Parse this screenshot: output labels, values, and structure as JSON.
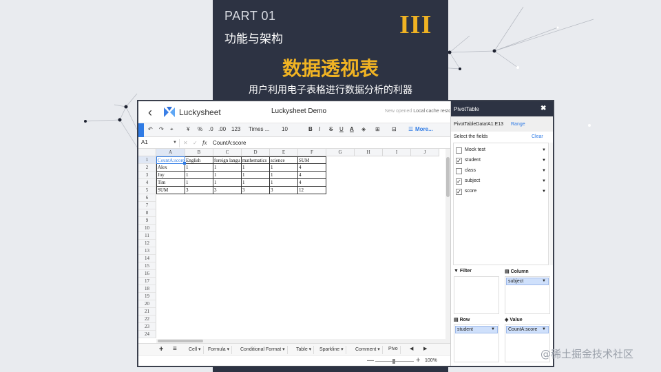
{
  "slide": {
    "part": "PART 01",
    "subtitle": "功能与架构",
    "roman": "III",
    "title": "数据透视表",
    "tagline": "用户利用电子表格进行数据分析的利器"
  },
  "app": {
    "logo_text": "Luckysheet",
    "doc_title": "Luckysheet Demo",
    "new_opened": "New opened",
    "cache_status": "Local cache resto",
    "toolbar": {
      "undo": "↶",
      "redo": "↷",
      "paint": "⌖",
      "currency": "¥",
      "percent": "%",
      "dec_minus": ".0",
      "dec_plus": ".00",
      "format": "123",
      "font": "Times ...",
      "size": "10",
      "bold": "B",
      "italic": "I",
      "strike": "S",
      "underline": "U",
      "text_color": "A",
      "fill": "◈",
      "border": "⊞",
      "merge": "⊟",
      "more": "More..."
    },
    "formula": {
      "cell_ref": "A1",
      "fx": "fx",
      "value": "CountA:score"
    },
    "columns": [
      "A",
      "B",
      "C",
      "D",
      "E",
      "F",
      "G",
      "H",
      "I",
      "J"
    ],
    "rows": [
      "1",
      "2",
      "3",
      "4",
      "5",
      "6",
      "7",
      "8",
      "9",
      "10",
      "11",
      "12",
      "13",
      "14",
      "15",
      "16",
      "17",
      "18",
      "19",
      "20",
      "21",
      "22",
      "23",
      "24"
    ],
    "table": [
      [
        "CountA:score",
        "English",
        "foreign langu",
        "mathematics",
        "science",
        "SUM"
      ],
      [
        "Alex",
        "1",
        "1",
        "1",
        "1",
        "4"
      ],
      [
        "Joy",
        "1",
        "1",
        "1",
        "1",
        "4"
      ],
      [
        "Tim",
        "1",
        "1",
        "1",
        "1",
        "4"
      ],
      [
        "SUM",
        "3",
        "3",
        "3",
        "3",
        "12"
      ]
    ],
    "sheet_tabs": [
      "Cell",
      "Formula",
      "Conditional Format",
      "Table",
      "Sparkline",
      "Comment",
      "Pivo"
    ],
    "zoom": "100%"
  },
  "pivot": {
    "title": "PivotTable",
    "close": "✖",
    "range": "PivotTableData!A1:E13",
    "range_link": "Range",
    "select_label": "Select the fields",
    "clear": "Clear",
    "fields": [
      {
        "label": "Mock test",
        "checked": false
      },
      {
        "label": "student",
        "checked": true
      },
      {
        "label": "class",
        "checked": false
      },
      {
        "label": "subject",
        "checked": true
      },
      {
        "label": "score",
        "checked": true
      }
    ],
    "filter_label": "Filter",
    "column_label": "Column",
    "column_value": "subject",
    "row_label": "Row",
    "row_value": "student",
    "value_label": "Value",
    "value_value": "CountA:score"
  },
  "watermark": "@稀土掘金技术社区"
}
